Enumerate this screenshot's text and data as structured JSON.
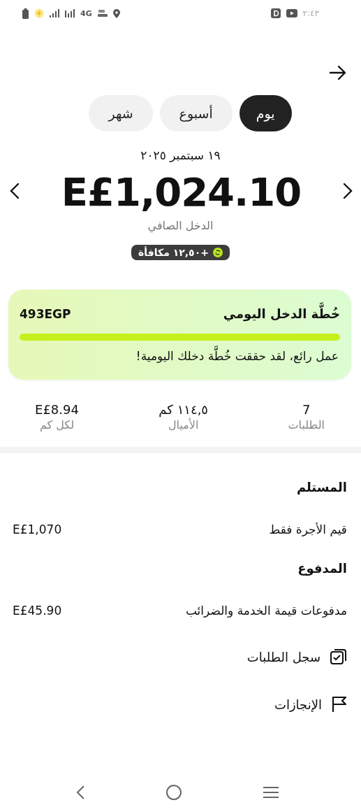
{
  "status_bar": {
    "network": "4G",
    "time": "٢:٤٣"
  },
  "tabs": [
    {
      "label": "يوم",
      "selected": true
    },
    {
      "label": "أسبوع",
      "selected": false
    },
    {
      "label": "شهر",
      "selected": false
    }
  ],
  "date": "١٩ سبتمبر ٢٠٢٥",
  "amount": "E£1,024.10",
  "amount_label": "الدخل الصافي",
  "bonus_badge": "+١٢,٥٠ مكافأة",
  "plan_card": {
    "title": "خُطَّة الدخل اليومي",
    "target": "493EGP",
    "level": 1,
    "message": "عمل رائع، لقد حققت خُطَّة دخلك اليومية!"
  },
  "stats": [
    {
      "value": "7",
      "label": "الطلبات"
    },
    {
      "value": "١١٤,٥ كم",
      "label": "الأميال"
    },
    {
      "value": "E£8.94",
      "label": "لكل كم"
    }
  ],
  "sections": [
    {
      "heading": "المستلم",
      "rows": [
        {
          "label": "قيم الأجرة فقط",
          "value": "E£1,070"
        }
      ]
    },
    {
      "heading": "المدفوع",
      "rows": [
        {
          "label": "مدفوعات قيمة الخدمة والضرائب",
          "value": "E£45.90"
        }
      ]
    }
  ],
  "links": [
    {
      "kind": "history",
      "label": "سجل الطلبات"
    },
    {
      "kind": "achievements",
      "label": "الإنجازات"
    }
  ]
}
